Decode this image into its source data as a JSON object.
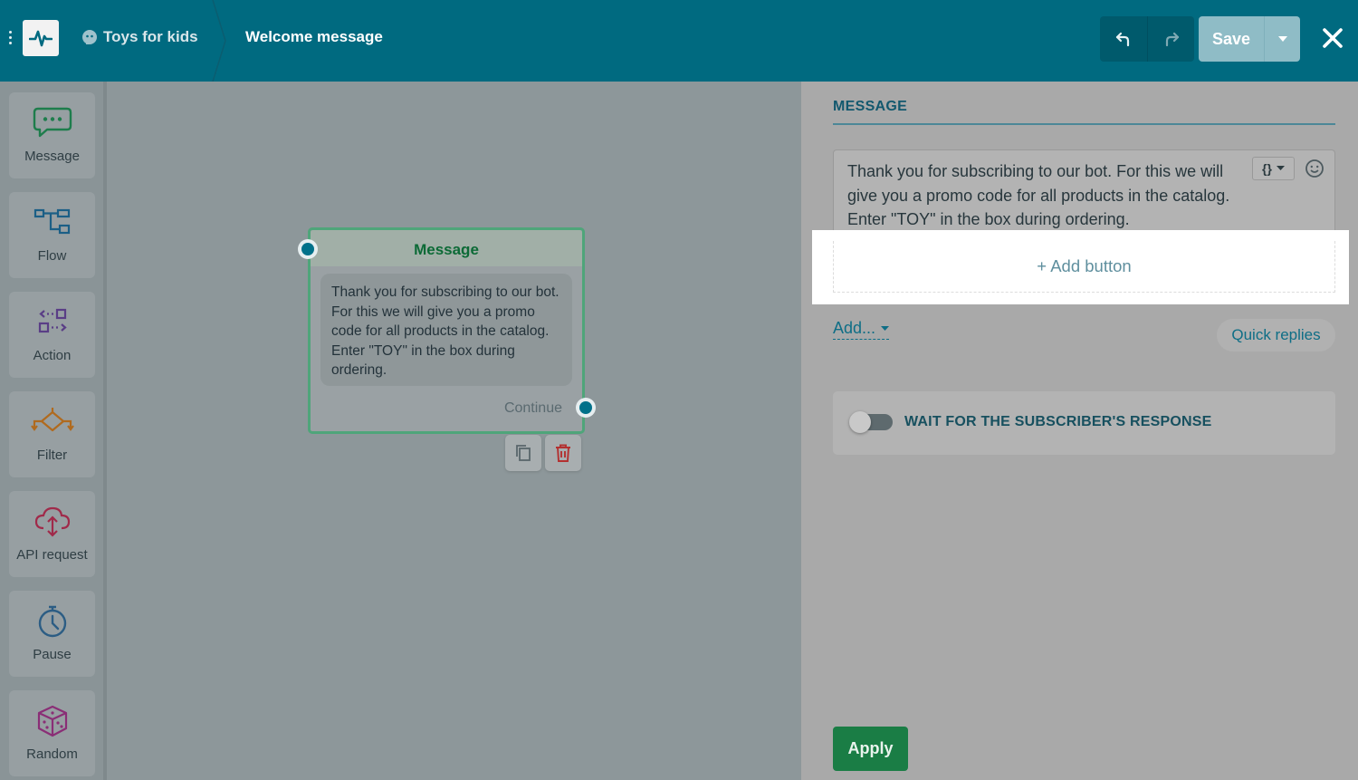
{
  "header": {
    "bot_name": "Toys for kids",
    "flow_name": "Welcome message",
    "save_label": "Save"
  },
  "toolbar": {
    "items": [
      {
        "label": "Message",
        "icon": "message-icon",
        "color": "#1e7d4c"
      },
      {
        "label": "Flow",
        "icon": "flow-icon",
        "color": "#1b5f86"
      },
      {
        "label": "Action",
        "icon": "action-icon",
        "color": "#5a3e86"
      },
      {
        "label": "Filter",
        "icon": "filter-icon",
        "color": "#b06a1e"
      },
      {
        "label": "API request",
        "icon": "api-request-icon",
        "color": "#a02a4a"
      },
      {
        "label": "Pause",
        "icon": "pause-clock-icon",
        "color": "#2c5d84"
      },
      {
        "label": "Random",
        "icon": "random-dice-icon",
        "color": "#8a2e76"
      }
    ]
  },
  "node": {
    "title": "Message",
    "text": "Thank you for subscribing to our bot. For this we will give you a promo code for all products in the catalog. Enter \"TOY\" in the box during ordering.",
    "continue_label": "Continue"
  },
  "panel": {
    "section_title": "MESSAGE",
    "message_text": "Thank you for subscribing to our bot. For this we will give you a promo code for all products in the catalog. Enter \"TOY\" in the box during ordering.",
    "add_button_label": "+ Add button",
    "add_menu_label": "Add...",
    "quick_replies_label": "Quick replies",
    "wait_label": "WAIT FOR THE SUBSCRIBER'S RESPONSE",
    "wait_enabled": false,
    "apply_label": "Apply"
  },
  "colors": {
    "header": "#006a80",
    "accent": "#0e6e86",
    "apply": "#1a7d45",
    "node_border": "#4fa57a"
  }
}
